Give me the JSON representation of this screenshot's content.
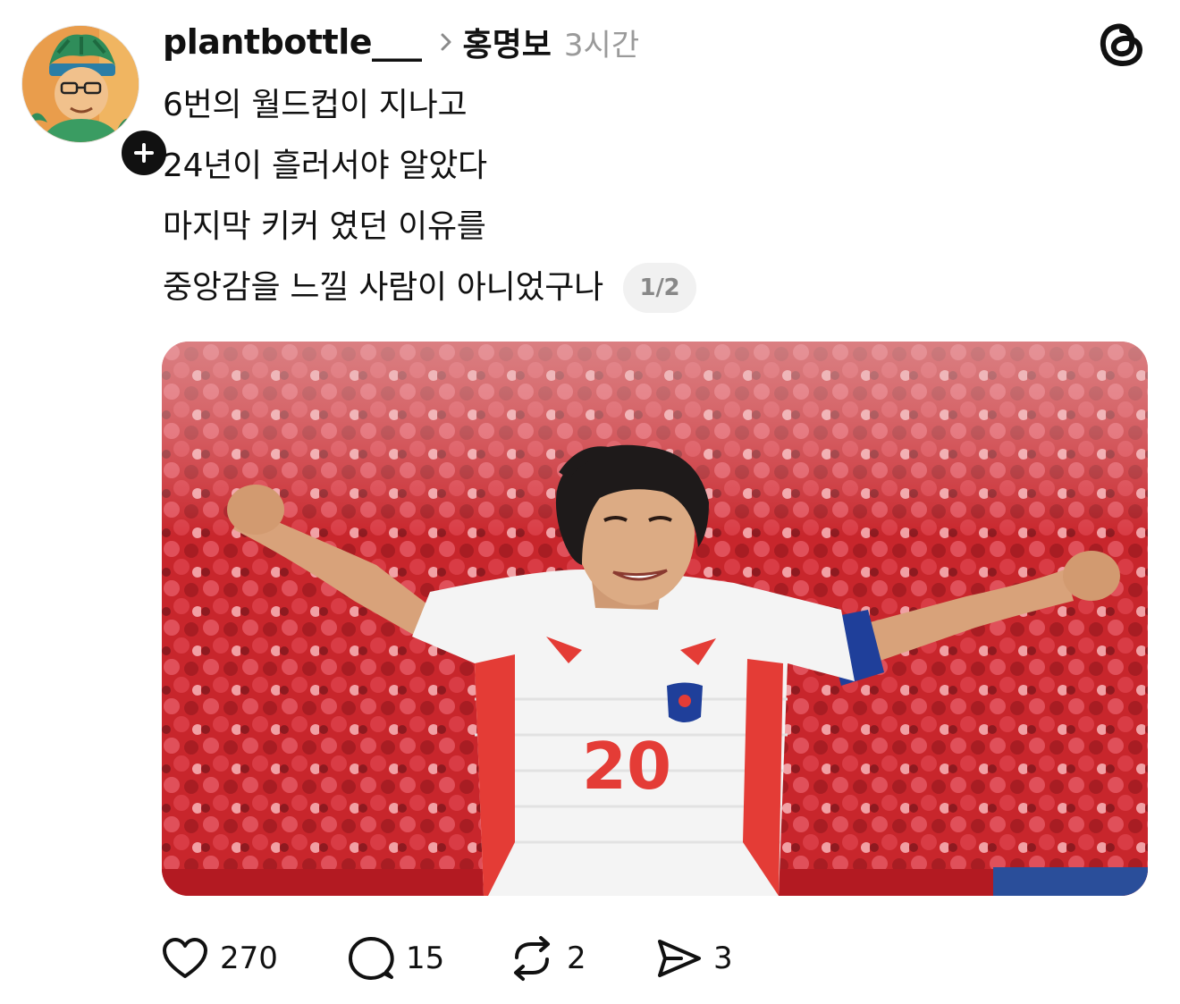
{
  "post": {
    "username": "plantbottle___",
    "reply_to": "홍명보",
    "time": "3시간",
    "lines": [
      "6번의 월드컵이 지나고",
      "24년이 흘러서야 알았다",
      "마지막 키커 였던 이유를",
      "중앙감을 느낄 사람이 아니었구나"
    ],
    "page_indicator": "1/2",
    "photo": {
      "jersey_number": "20"
    }
  },
  "actions": {
    "likes": "270",
    "comments": "15",
    "reposts": "2",
    "shares": "3"
  },
  "icons": {
    "like": "heart-icon",
    "comment": "comment-icon",
    "repost": "repost-icon",
    "share": "share-icon",
    "follow": "plus-icon",
    "app": "threads-logo-icon"
  },
  "colors": {
    "text": "#111111",
    "muted": "#9a9a9a",
    "badge_bg": "#f1f1f1",
    "crowd_red": "#c8262c"
  }
}
